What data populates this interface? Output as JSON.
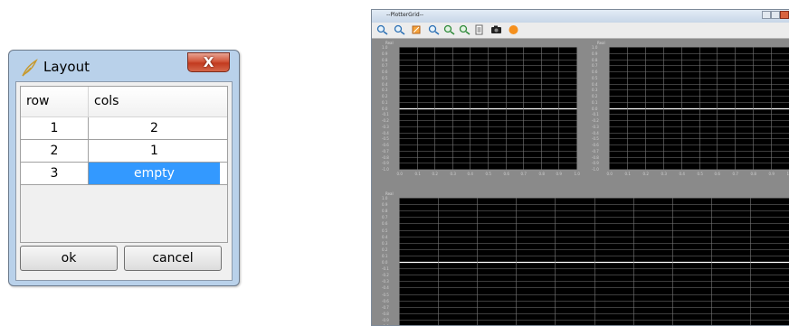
{
  "dialog": {
    "title": "Layout",
    "close_glyph": "X",
    "icon": "feather-icon",
    "table": {
      "headers": [
        "row",
        "cols"
      ],
      "rows": [
        {
          "row": "1",
          "cols": "2"
        },
        {
          "row": "2",
          "cols": "1"
        },
        {
          "row": "3",
          "cols": "empty"
        }
      ],
      "selected_cell": "3-cols"
    },
    "ok_label": "ok",
    "cancel_label": "cancel"
  },
  "plotter": {
    "title": "--PlotterGrid--",
    "toolbar_icons": [
      "zoom-in-icon",
      "zoom-out-icon",
      "fit-icon",
      "zoom-x-icon",
      "zoom-y-icon",
      "reset-zoom-icon",
      "document-icon",
      "camera-icon",
      "record-icon"
    ],
    "plot_title": "Real",
    "y_ticks": [
      "1.0",
      "0.9",
      "0.8",
      "0.7",
      "0.6",
      "0.5",
      "0.4",
      "0.3",
      "0.2",
      "0.1",
      "0.0",
      "-0.1",
      "-0.2",
      "-0.3",
      "-0.4",
      "-0.5",
      "-0.6",
      "-0.7",
      "-0.8",
      "-0.9",
      "-1.0"
    ],
    "x_ticks": [
      "0.0",
      "0.1",
      "0.2",
      "0.3",
      "0.4",
      "0.5",
      "0.6",
      "0.7",
      "0.8",
      "0.9",
      "1.0"
    ],
    "accent": "#3399ff"
  }
}
